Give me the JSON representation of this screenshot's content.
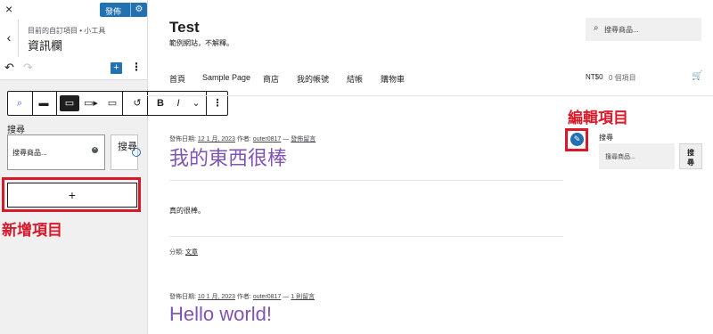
{
  "customizer": {
    "close_icon": "×",
    "publish_label": "發佈",
    "gear_icon": "⚙",
    "back_icon": "‹",
    "breadcrumb": "目前的自訂項目 • 小工具",
    "section_title": "資訊欄",
    "undo_icon": "↶",
    "redo_icon": "↷",
    "add_block_icon": "+",
    "more_icon": "⋮",
    "toolbar_icons": [
      "⌕",
      "▬",
      "▭",
      "▭▸",
      "▭",
      "↺",
      "B",
      "I",
      "⌄",
      "⋮"
    ],
    "search_block": {
      "label": "搜尋",
      "placeholder": "搜尋商品...",
      "clear_icon": "×",
      "button_label": "搜尋"
    },
    "add_item_icon": "+",
    "add_item_annotation": "新增項目"
  },
  "site": {
    "title": "Test",
    "tagline": "範例網站，不解釋。",
    "header_search_placeholder": "搜尋商品...",
    "search_icon": "⌕",
    "nav": [
      "首頁",
      "Sample Page",
      "商店",
      "我的帳號",
      "結帳",
      "購物車"
    ],
    "cart_amount": "NT$0",
    "cart_count": "0 個項目",
    "cart_icon": "🛒",
    "posts": [
      {
        "meta_prefix": "發佈日期:",
        "date": "12 1 月, 2023",
        "author_prefix": "作者:",
        "author": "outer0817",
        "sep": "—",
        "comments": "發佈留言",
        "title": "我的東西很棒",
        "body": "真的很棒。",
        "category_prefix": "分類:",
        "category": "文章"
      },
      {
        "meta_prefix": "發佈日期:",
        "date": "10 1 月, 2023",
        "author_prefix": "作者:",
        "author": "outer0817",
        "sep": "—",
        "comments": "1 則留言",
        "title": "Hello world!"
      }
    ],
    "edit_annotation": "編輯項目",
    "edit_icon": "✎",
    "widget": {
      "title": "搜尋",
      "placeholder": "搜尋商品...",
      "button_label": "搜尋"
    }
  },
  "colors": {
    "accent_blue": "#2271b1",
    "annotation_red": "#d7192a",
    "post_title_purple": "#7f54b3"
  }
}
